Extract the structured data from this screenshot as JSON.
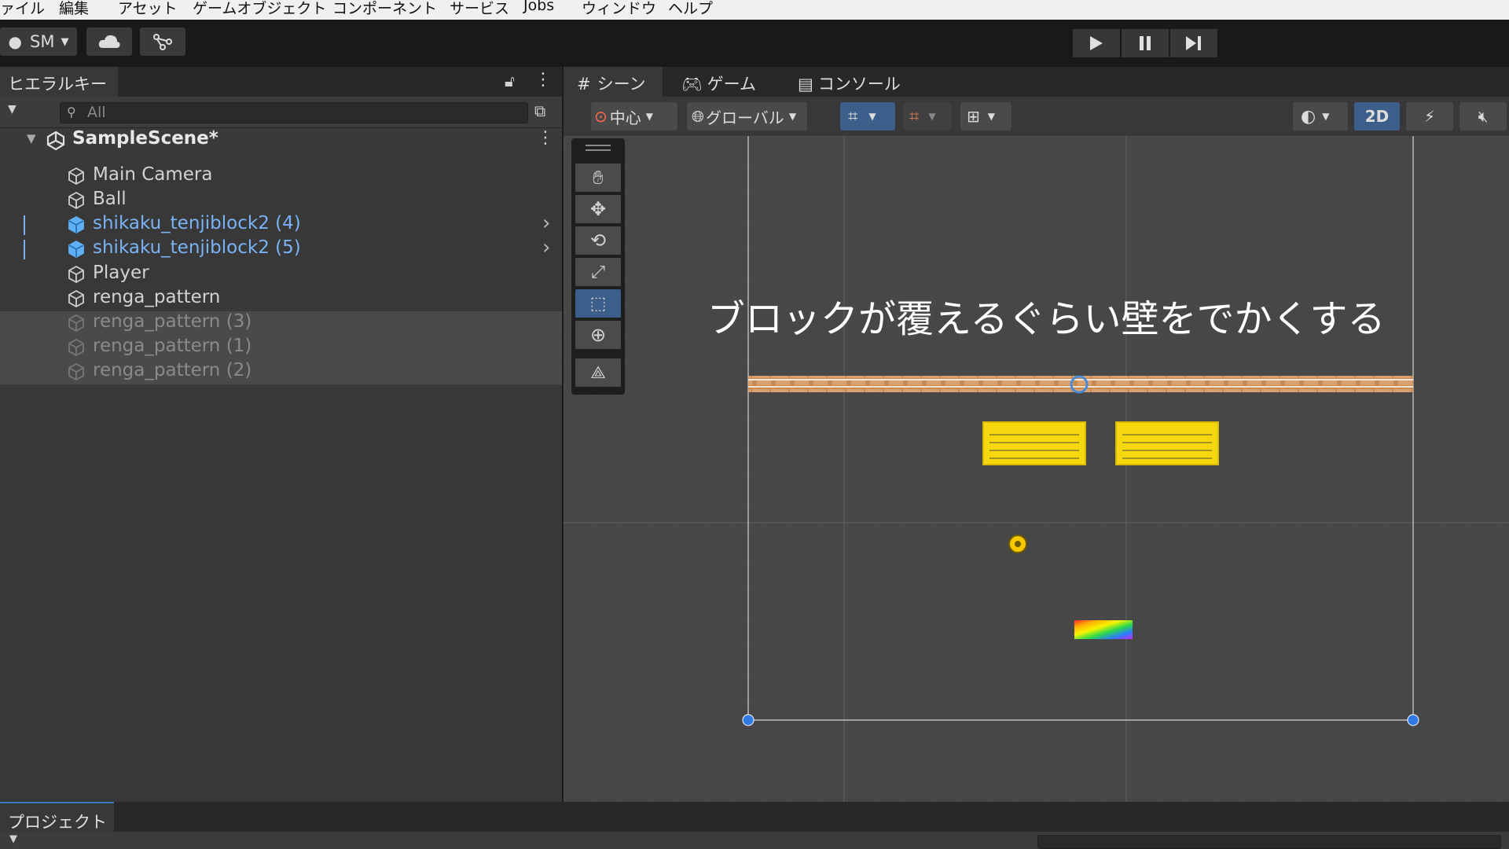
{
  "menubar": {
    "items": [
      "ァイル",
      "編集",
      "アセット",
      "ゲームオブジェクト",
      "コンポーネント",
      "サービス",
      "Jobs",
      "ウィンドウ",
      "ヘルプ"
    ]
  },
  "toolbar": {
    "account_label": "SM",
    "icons": [
      "account-icon",
      "cloud-icon",
      "collab-icon",
      "play-icon",
      "pause-icon",
      "step-icon"
    ]
  },
  "hierarchy": {
    "tab_label": "ヒエラルキー",
    "search_placeholder": "All",
    "scene_name": "SampleScene*",
    "items": [
      {
        "label": "Main Camera",
        "style": "normal"
      },
      {
        "label": "Ball",
        "style": "normal"
      },
      {
        "label": "shikaku_tenjiblock2 (4)",
        "style": "prefab"
      },
      {
        "label": "shikaku_tenjiblock2 (5)",
        "style": "prefab"
      },
      {
        "label": "Player",
        "style": "normal"
      },
      {
        "label": "renga_pattern",
        "style": "normal"
      },
      {
        "label": "renga_pattern (3)",
        "style": "disabled"
      },
      {
        "label": "renga_pattern (1)",
        "style": "disabled"
      },
      {
        "label": "renga_pattern (2)",
        "style": "disabled"
      }
    ]
  },
  "scene": {
    "tabs": {
      "scene": "シーン",
      "game": "ゲーム",
      "console": "コンソール"
    },
    "pivot_label": "中心",
    "space_label": "グローバル",
    "mode_2d": "2D"
  },
  "overlay": {
    "annotation": "ブロックが覆えるぐらい壁をでかくする"
  },
  "project": {
    "tab_label": "プロジェクト"
  },
  "colors": {
    "accent": "#3a79bb",
    "prefab_text": "#7ab3f5",
    "block_yellow": "#f5d90e",
    "wall_brick": "#c98a4f"
  }
}
